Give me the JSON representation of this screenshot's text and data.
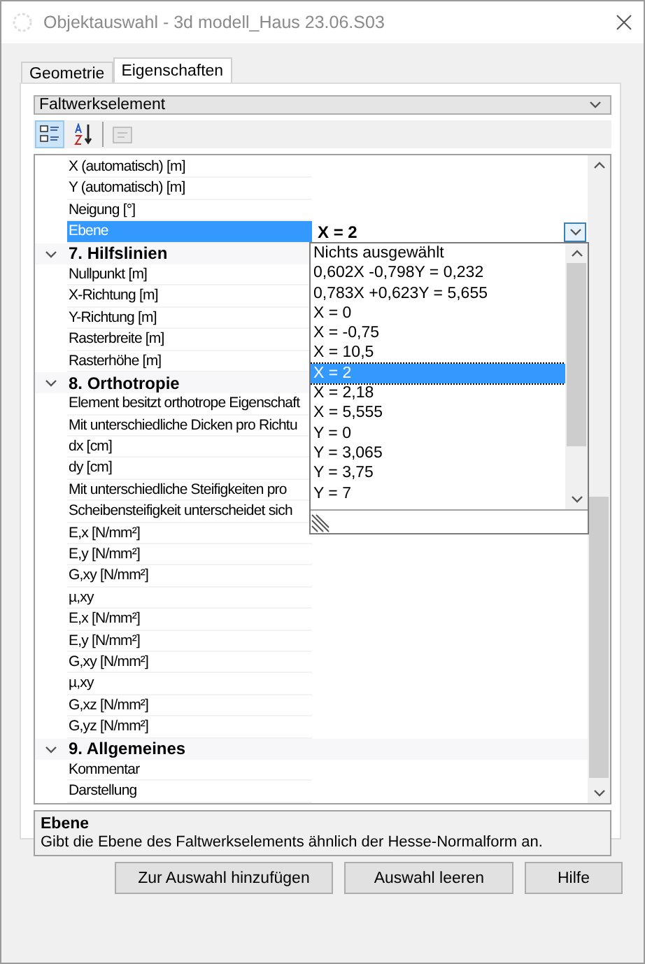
{
  "window": {
    "title": "Objektauswahl - 3d modell_Haus 23.06.S03"
  },
  "tabs": [
    {
      "label": "Geometrie",
      "selected": false
    },
    {
      "label": "Eigenschaften",
      "selected": true
    }
  ],
  "object_type": {
    "value": "Faltwerkselement"
  },
  "toolbar": {
    "categorized": {
      "selected": true
    },
    "alphabetical": {
      "selected": false
    },
    "property_pages": {
      "disabled": true
    }
  },
  "property_grid": {
    "items": [
      {
        "label": "X (automatisch) [m]",
        "selected": false
      },
      {
        "label": "Y (automatisch) [m]",
        "selected": false
      },
      {
        "label": "Neigung [°]",
        "selected": false
      },
      {
        "label": "Ebene",
        "selected": true,
        "value": "X = 2"
      }
    ],
    "categories": [
      {
        "title": "7. Hilfslinien",
        "expanded": true,
        "items": [
          {
            "label": "Nullpunkt [m]",
            "selected": false
          },
          {
            "label": "X-Richtung [m]",
            "selected": false
          },
          {
            "label": "Y-Richtung [m]",
            "selected": false
          },
          {
            "label": "Rasterbreite [m]",
            "selected": false
          },
          {
            "label": "Rasterhöhe [m]",
            "selected": false
          }
        ]
      },
      {
        "title": "8. Orthotropie",
        "expanded": true,
        "items": [
          {
            "label": "Element besitzt orthotrope Eigenschaft",
            "selected": false
          },
          {
            "label": "Mit unterschiedliche Dicken pro Richtu",
            "selected": false
          },
          {
            "label": "dx [cm]",
            "selected": false
          },
          {
            "label": "dy [cm]",
            "selected": false
          },
          {
            "label": "Mit unterschiedliche Steifigkeiten pro",
            "selected": false
          },
          {
            "label": "Scheibensteifigkeit unterscheidet sich",
            "selected": false
          },
          {
            "label": "E,x [N/mm²]",
            "selected": false
          },
          {
            "label": "E,y [N/mm²]",
            "selected": false
          },
          {
            "label": "G,xy [N/mm²]",
            "selected": false
          },
          {
            "label": "µ,xy",
            "selected": false
          },
          {
            "label": "E,x [N/mm²]",
            "selected": false
          },
          {
            "label": "E,y [N/mm²]",
            "selected": false
          },
          {
            "label": "G,xy [N/mm²]",
            "selected": false
          },
          {
            "label": "µ,xy",
            "selected": false
          },
          {
            "label": "G,xz [N/mm²]",
            "selected": false
          },
          {
            "label": "G,yz [N/mm²]",
            "selected": false
          }
        ]
      },
      {
        "title": "9. Allgemeines",
        "expanded": true,
        "items": [
          {
            "label": "Kommentar",
            "selected": false
          },
          {
            "label": "Darstellung",
            "selected": false
          }
        ]
      }
    ]
  },
  "dropdown_list": {
    "options": [
      {
        "label": "Nichts ausgewählt",
        "selected": false
      },
      {
        "label": "0,602X -0,798Y = 0,232",
        "selected": false
      },
      {
        "label": "0,783X +0,623Y = 5,655",
        "selected": false
      },
      {
        "label": "X = 0",
        "selected": false
      },
      {
        "label": "X = -0,75",
        "selected": false
      },
      {
        "label": "X = 10,5",
        "selected": false
      },
      {
        "label": "X = 2",
        "selected": true
      },
      {
        "label": "X = 2,18",
        "selected": false
      },
      {
        "label": "X = 5,555",
        "selected": false
      },
      {
        "label": "Y = 0",
        "selected": false
      },
      {
        "label": "Y = 3,065",
        "selected": false
      },
      {
        "label": "Y = 3,75",
        "selected": false
      },
      {
        "label": "Y = 7",
        "selected": false
      }
    ]
  },
  "description": {
    "title": "Ebene",
    "text": "Gibt die Ebene des Faltwerkselements ähnlich der Hesse-Normalform an."
  },
  "buttons": [
    {
      "label": "Zur Auswahl hinzufügen"
    },
    {
      "label": "Auswahl leeren"
    },
    {
      "label": "Hilfe"
    }
  ]
}
